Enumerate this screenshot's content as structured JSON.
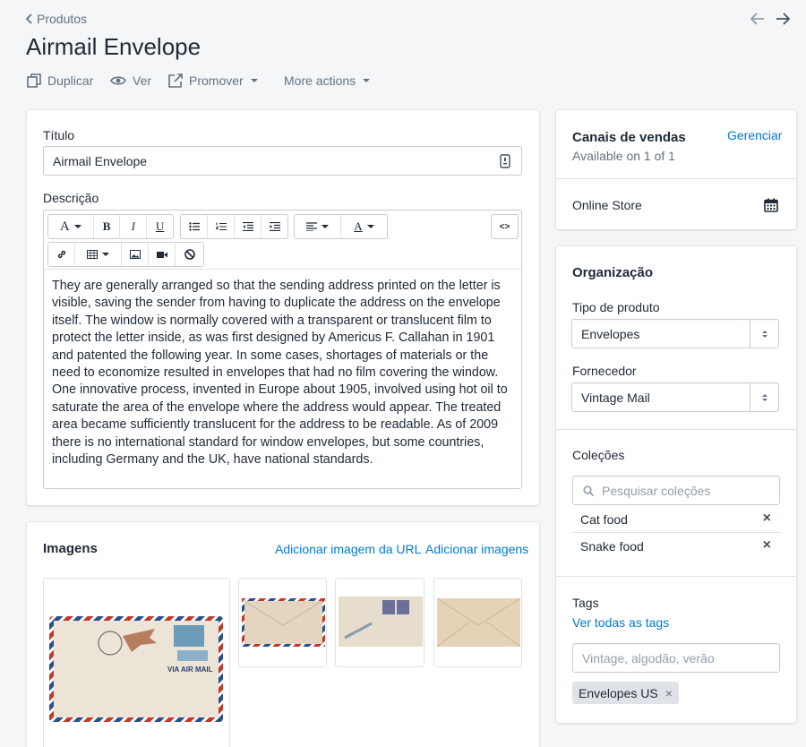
{
  "header": {
    "breadcrumb": "Produtos",
    "title": "Airmail Envelope",
    "actions": {
      "duplicate": "Duplicar",
      "view": "Ver",
      "promote": "Promover",
      "more": "More actions"
    }
  },
  "product": {
    "title_label": "Título",
    "title_value": "Airmail Envelope",
    "description_label": "Descrição",
    "description_text": "They are generally arranged so that the sending address printed on the letter is visible, saving the sender from having to duplicate the address on the envelope itself. The window is normally covered with a transparent or translucent film to protect the letter inside, as was first designed by Americus F. Callahan in 1901 and patented the following year. In some cases, shortages of materials or the need to economize resulted in envelopes that had no film covering the window. One innovative process, invented in Europe about 1905, involved using hot oil to saturate the area of the envelope where the address would appear. The treated area became sufficiently translucent for the address to be readable. As of 2009 there is no international standard for window envelopes, but some countries, including Germany and the UK, have national standards.",
    "toolbar": {
      "font": "A",
      "bold": "B",
      "italic": "I",
      "underline": "U",
      "color": "A",
      "code": "<>"
    }
  },
  "images": {
    "title": "Imagens",
    "add_from_url": "Adicionar imagem da URL",
    "add_images": "Adicionar imagens",
    "main_stamp": "VIA AIR MAIL"
  },
  "sales_channels": {
    "title": "Canais de vendas",
    "manage": "Gerenciar",
    "available": "Available on 1 of 1",
    "channel": "Online Store"
  },
  "organization": {
    "title": "Organização",
    "product_type_label": "Tipo de produto",
    "product_type_value": "Envelopes",
    "vendor_label": "Fornecedor",
    "vendor_value": "Vintage Mail",
    "collections_label": "Coleções",
    "collections_search_placeholder": "Pesquisar coleções",
    "collections": [
      {
        "name": "Cat food",
        "remove": "×"
      },
      {
        "name": "Snake food",
        "remove": "×"
      }
    ],
    "tags_label": "Tags",
    "view_all_tags": "Ver todas as tags",
    "tags_placeholder": "Vintage, algodão, verão",
    "tags": [
      {
        "name": "Envelopes US",
        "remove": "×"
      }
    ]
  },
  "colors": {
    "accent": "#007ace",
    "text": "#212b36",
    "muted": "#637381",
    "background": "#f4f6f8"
  },
  "icons": {
    "back": "chevron-left-icon",
    "prev": "arrow-left-icon",
    "next": "arrow-right-icon",
    "duplicate": "duplicate-icon",
    "view": "eye-icon",
    "promote": "external-icon",
    "calendar": "calendar-icon",
    "search": "search-icon"
  }
}
